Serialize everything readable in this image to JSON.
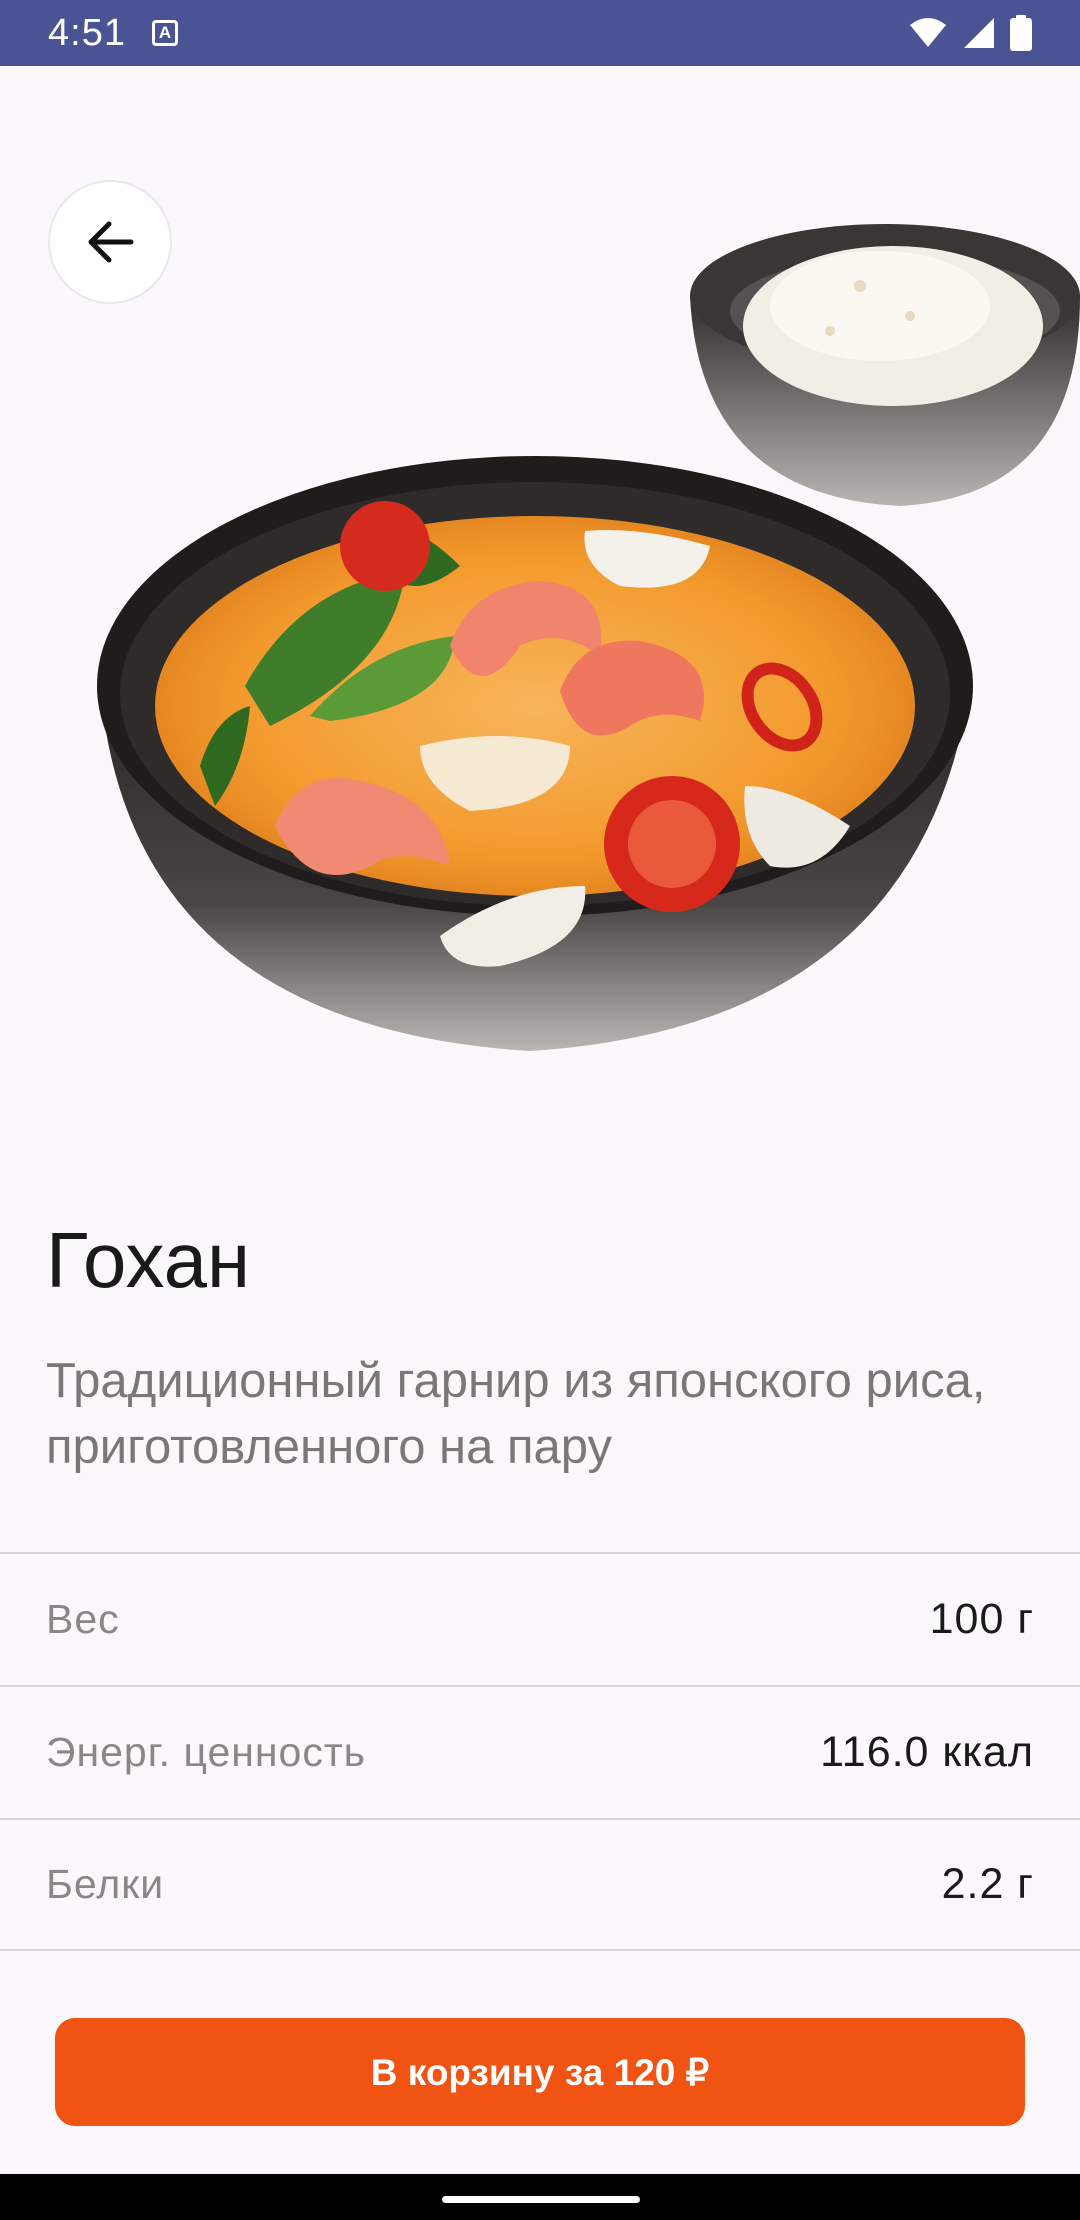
{
  "status_bar": {
    "time": "4:51",
    "notification_icon": "a-box-icon",
    "icons": [
      "wifi-icon",
      "signal-icon",
      "battery-icon"
    ],
    "background": "#4A5494"
  },
  "hero": {
    "back_icon": "arrow-left-icon",
    "image": "soup-bowl-with-rice-image"
  },
  "product": {
    "title": "Гохан",
    "description": "Традиционный гарнир из японского риса, приготовленного на пару",
    "properties": [
      {
        "label": "Вес",
        "value": "100 г"
      },
      {
        "label": "Энерг. ценность",
        "value": "116.0 ккал"
      },
      {
        "label": "Белки",
        "value": "2.2 г"
      }
    ]
  },
  "cart": {
    "label": "В корзину за 120 ₽",
    "color": "#F05312"
  }
}
